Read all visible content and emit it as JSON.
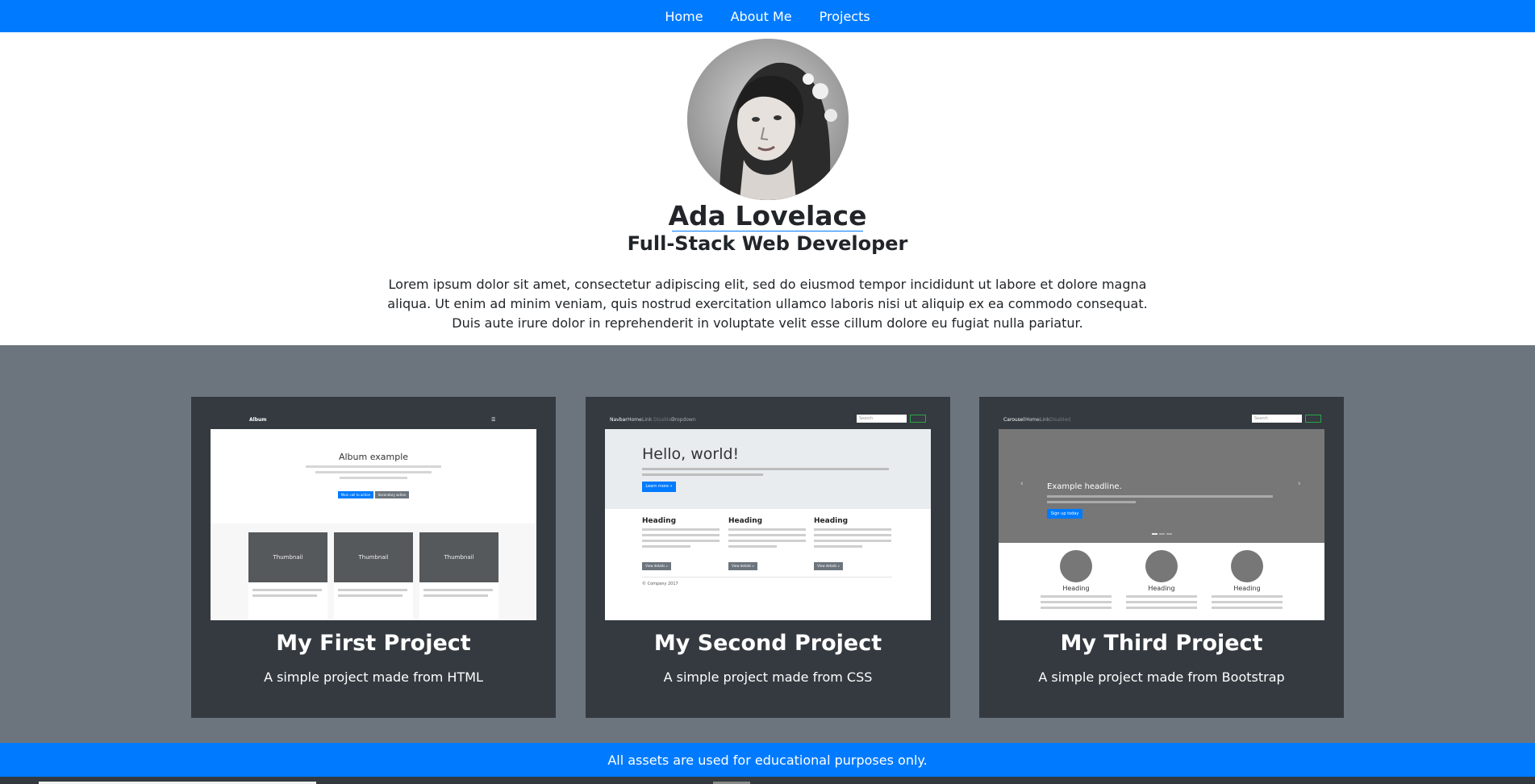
{
  "nav": {
    "items": [
      "Home",
      "About Me",
      "Projects"
    ]
  },
  "profile": {
    "name": "Ada Lovelace",
    "role": "Full-Stack Web Developer",
    "bio": "Lorem ipsum dolor sit amet, consectetur adipiscing elit, sed do eiusmod tempor incididunt ut labore et dolore magna aliqua. Ut enim ad minim veniam, quis nostrud exercitation ullamco laboris nisi ut aliquip ex ea commodo consequat. Duis aute irure dolor in reprehenderit in voluptate velit esse cillum dolore eu fugiat nulla pariatur."
  },
  "projects": [
    {
      "title": "My First Project",
      "description": "A simple project made from HTML",
      "thumb": {
        "brand": "Album",
        "heading": "Album example",
        "primary_btn": "Main call to action",
        "secondary_btn": "Secondary action",
        "tile_label": "Thumbnail"
      }
    },
    {
      "title": "My Second Project",
      "description": "A simple project made from CSS",
      "thumb": {
        "brand": "Navbar",
        "links": [
          "Home",
          "Link",
          "Disabled",
          "Dropdown"
        ],
        "search": "Search",
        "heading": "Hello, world!",
        "btn": "Learn more »",
        "col_heading": "Heading",
        "col_btn": "View details »",
        "footer": "© Company 2017"
      }
    },
    {
      "title": "My Third Project",
      "description": "A simple project made from Bootstrap",
      "thumb": {
        "brand": "Carousel",
        "links": [
          "Home",
          "Link",
          "Disabled"
        ],
        "search": "Search",
        "headline": "Example headline.",
        "btn": "Sign up today",
        "col_heading": "Heading"
      }
    }
  ],
  "footer": {
    "text": "All assets are used for educational purposes only."
  },
  "colors": {
    "primary": "#007bff",
    "dark": "#343a40",
    "secondary": "#6c757d"
  }
}
